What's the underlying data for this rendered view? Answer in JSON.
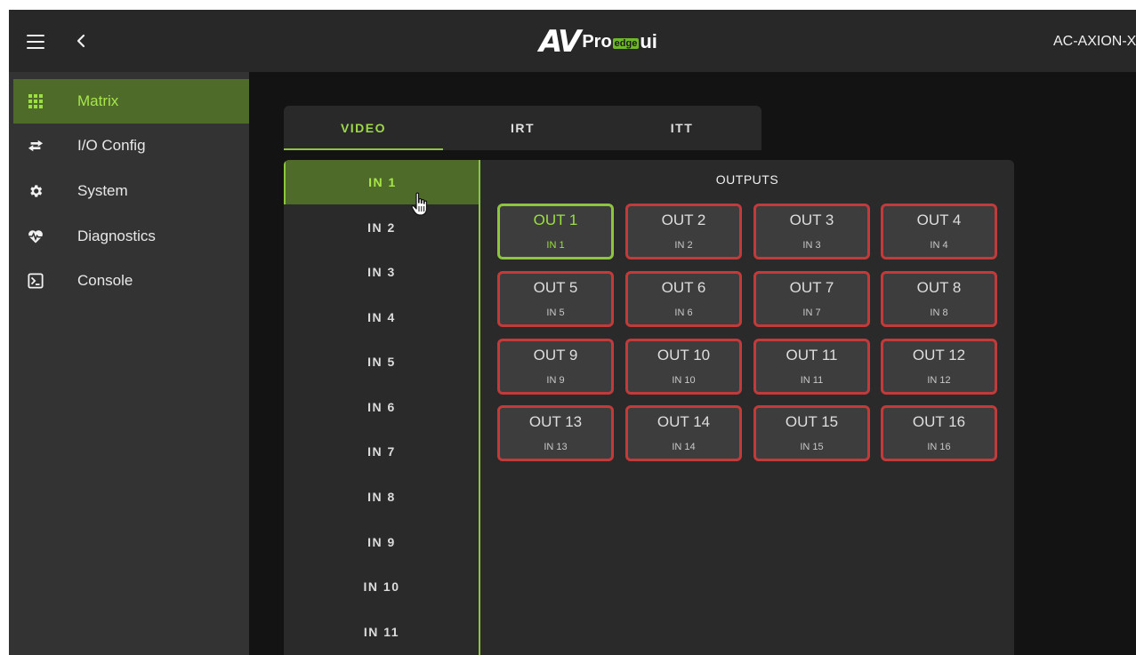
{
  "header": {
    "logo": {
      "av": "AV",
      "pro": "Pro",
      "edge": "edge",
      "ui": "ui"
    },
    "device_name": "AC-AXION-X"
  },
  "sidebar": {
    "items": [
      {
        "label": "Matrix",
        "icon": "grid-icon",
        "active": true
      },
      {
        "label": "I/O Config",
        "icon": "swap-arrows-icon",
        "active": false
      },
      {
        "label": "System",
        "icon": "gear-icon",
        "active": false
      },
      {
        "label": "Diagnostics",
        "icon": "heartbeat-icon",
        "active": false
      },
      {
        "label": "Console",
        "icon": "terminal-icon",
        "active": false
      }
    ]
  },
  "tabs": [
    {
      "label": "VIDEO",
      "active": true
    },
    {
      "label": "IRT",
      "active": false
    },
    {
      "label": "ITT",
      "active": false
    }
  ],
  "inputs": [
    "IN 1",
    "IN 2",
    "IN 3",
    "IN 4",
    "IN 5",
    "IN 6",
    "IN 7",
    "IN 8",
    "IN 9",
    "IN 10",
    "IN 11"
  ],
  "selected_input": "IN 1",
  "outputs": {
    "title": "OUTPUTS",
    "items": [
      {
        "name": "OUT 1",
        "source": "IN 1",
        "routed": true
      },
      {
        "name": "OUT 2",
        "source": "IN 2",
        "routed": false
      },
      {
        "name": "OUT 3",
        "source": "IN 3",
        "routed": false
      },
      {
        "name": "OUT 4",
        "source": "IN 4",
        "routed": false
      },
      {
        "name": "OUT 5",
        "source": "IN 5",
        "routed": false
      },
      {
        "name": "OUT 6",
        "source": "IN 6",
        "routed": false
      },
      {
        "name": "OUT 7",
        "source": "IN 7",
        "routed": false
      },
      {
        "name": "OUT 8",
        "source": "IN 8",
        "routed": false
      },
      {
        "name": "OUT 9",
        "source": "IN 9",
        "routed": false
      },
      {
        "name": "OUT 10",
        "source": "IN 10",
        "routed": false
      },
      {
        "name": "OUT 11",
        "source": "IN 11",
        "routed": false
      },
      {
        "name": "OUT 12",
        "source": "IN 12",
        "routed": false
      },
      {
        "name": "OUT 13",
        "source": "IN 13",
        "routed": false
      },
      {
        "name": "OUT 14",
        "source": "IN 14",
        "routed": false
      },
      {
        "name": "OUT 15",
        "source": "IN 15",
        "routed": false
      },
      {
        "name": "OUT 16",
        "source": "IN 16",
        "routed": false
      }
    ]
  },
  "colors": {
    "accent": "#8cc63f",
    "active_bg": "#4e6b2a",
    "unrouted_border": "#c23a3a"
  }
}
